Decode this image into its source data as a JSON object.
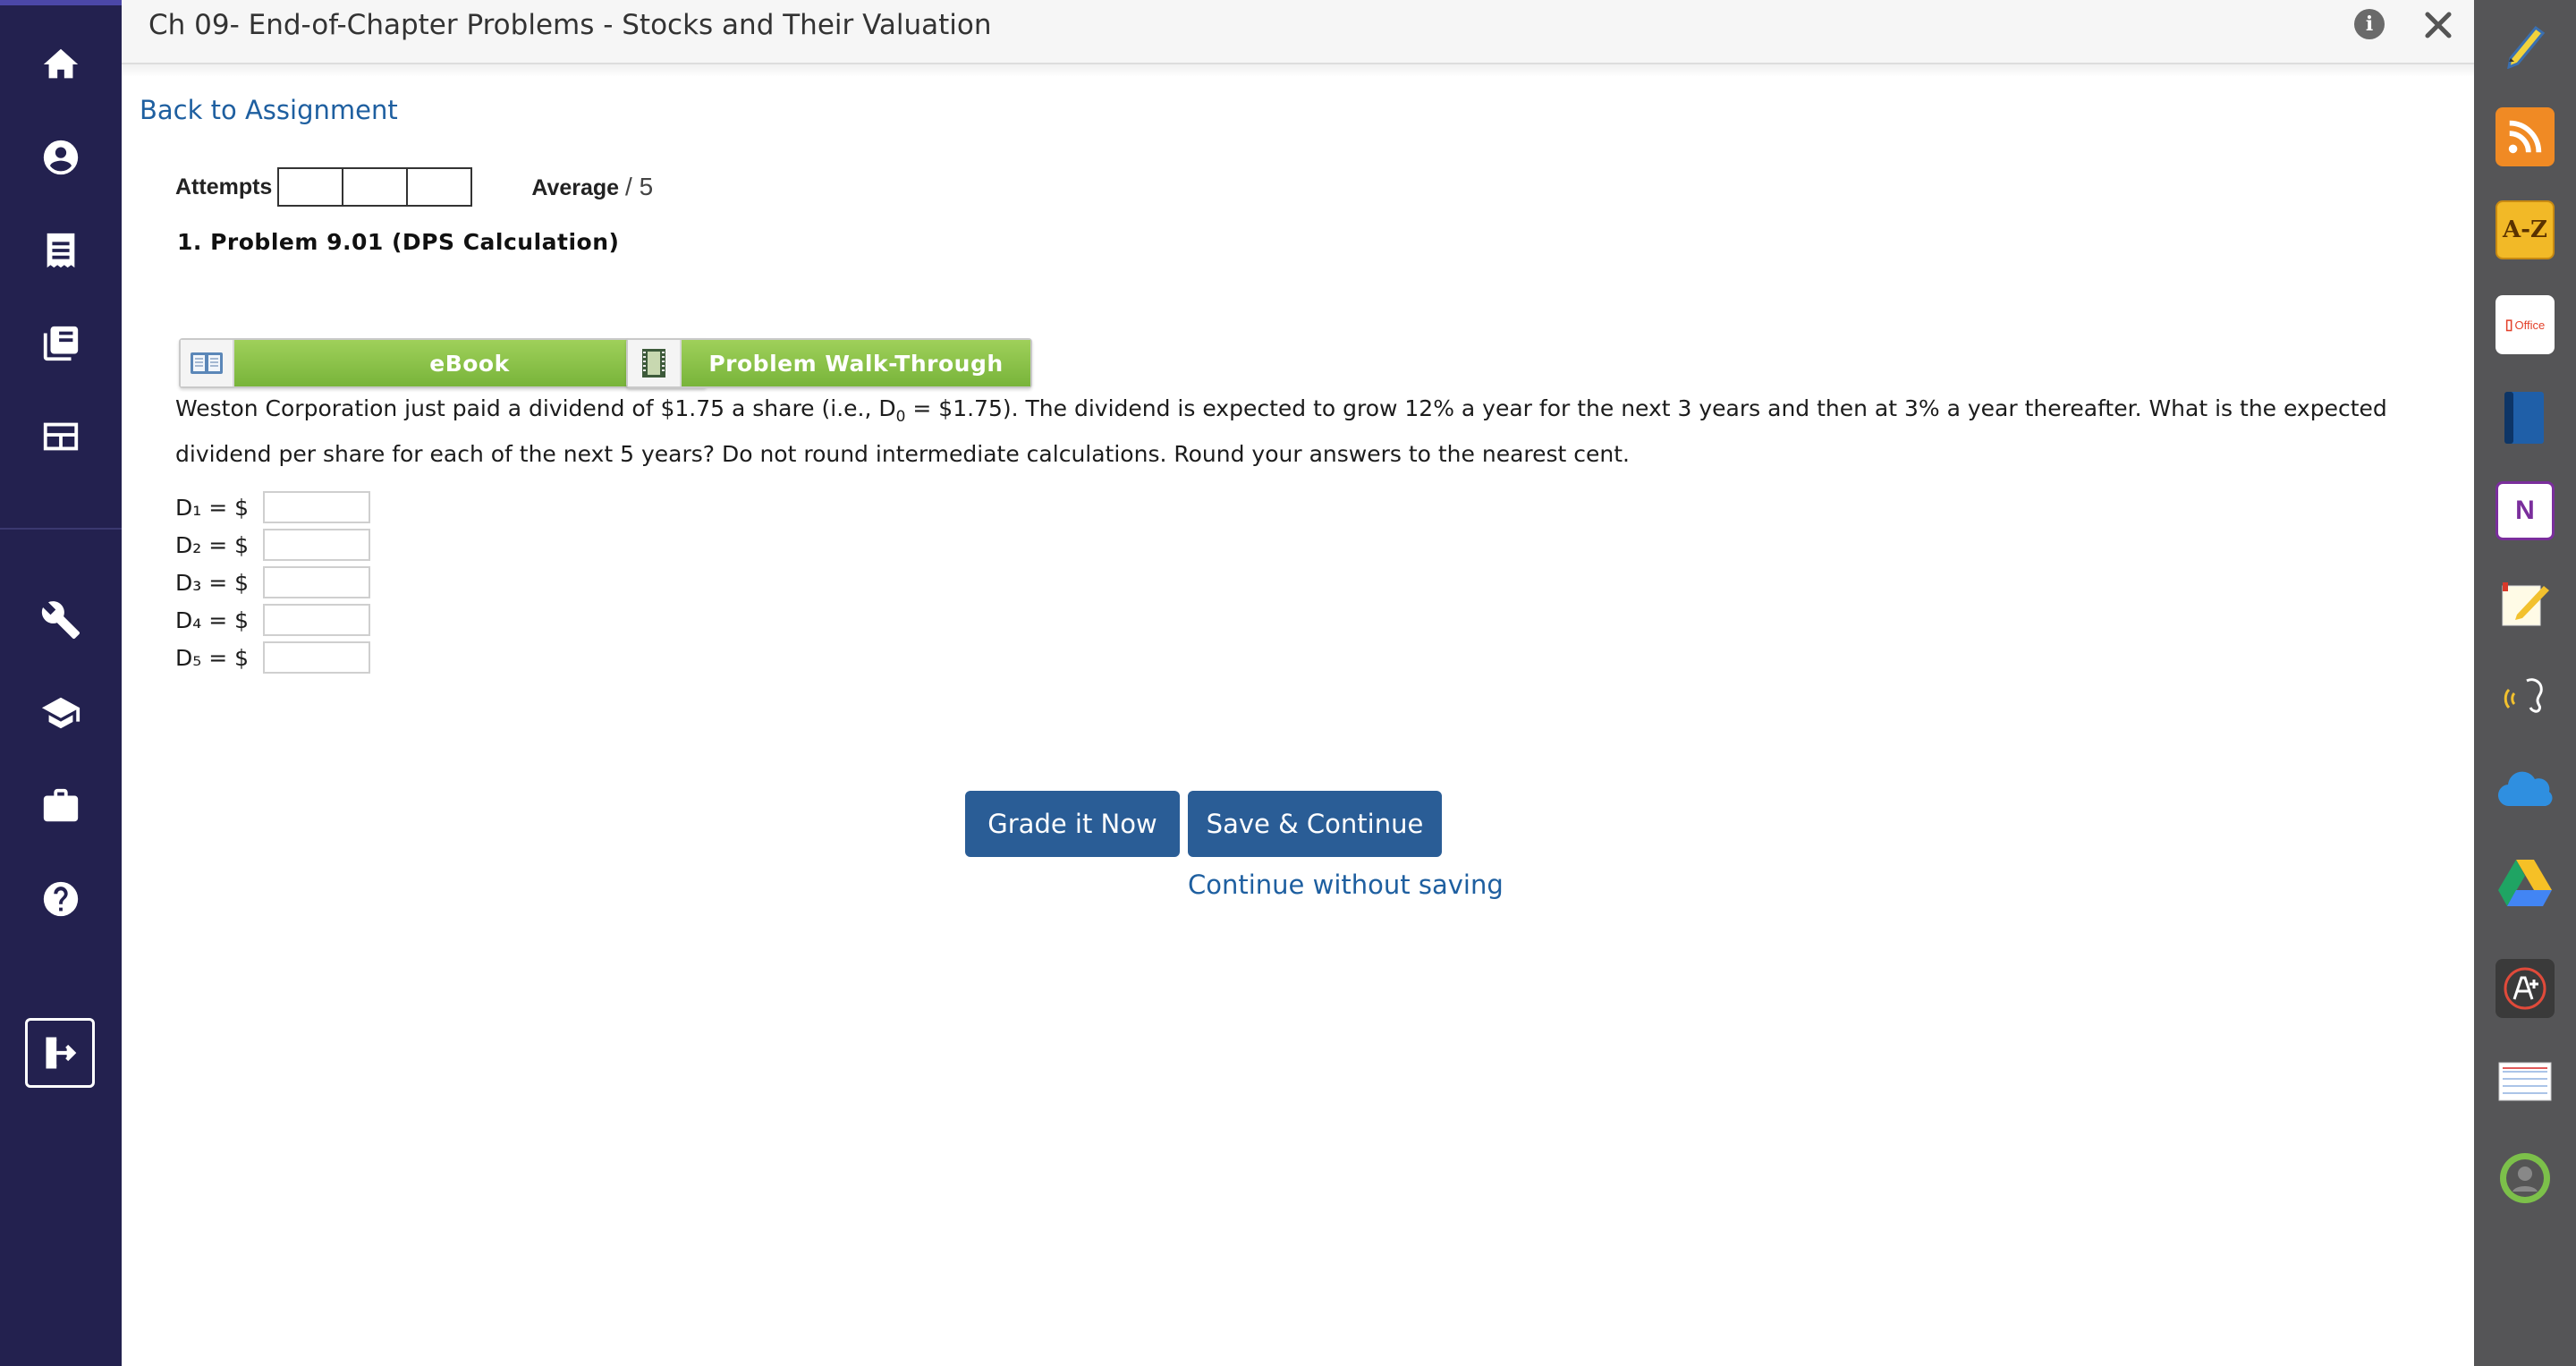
{
  "header": {
    "title": "Ch 09- End-of-Chapter Problems - Stocks and Their Valuation",
    "info_icon": "i"
  },
  "nav": {
    "back_link": "Back to Assignment"
  },
  "attempts": {
    "label": "Attempts",
    "average_label": "Average",
    "average_value": "/ 5"
  },
  "problem": {
    "title": "1.  Problem 9.01 (DPS Calculation)",
    "ebook_label": "eBook",
    "walkthrough_label": "Problem Walk-Through",
    "prompt_part1": "Weston Corporation just paid a dividend of $1.75 a share (i.e., D",
    "prompt_sub": "0",
    "prompt_part2": " = $1.75). The dividend is expected to grow 12% a year for the next 3 years and then at 3% a year thereafter. What is the expected dividend per share for each of the next 5 years? Do not round intermediate calculations. Round your answers to the nearest cent.",
    "answers": [
      {
        "label": "D₁ = $",
        "value": ""
      },
      {
        "label": "D₂ = $",
        "value": ""
      },
      {
        "label": "D₃ = $",
        "value": ""
      },
      {
        "label": "D₄ = $",
        "value": ""
      },
      {
        "label": "D₅ = $",
        "value": ""
      }
    ]
  },
  "actions": {
    "grade_label": "Grade it Now",
    "save_label": "Save & Continue",
    "continue_label": "Continue without saving"
  },
  "toolbar": {
    "az_label": "A-Z",
    "office_label": "Office",
    "onenote_label": "N"
  },
  "colors": {
    "nav_bg": "#23214f",
    "toolbar_bg": "#555557",
    "primary_button": "#2a5d96",
    "link": "#1e5fa0",
    "resource_green": "#8cc34b"
  }
}
